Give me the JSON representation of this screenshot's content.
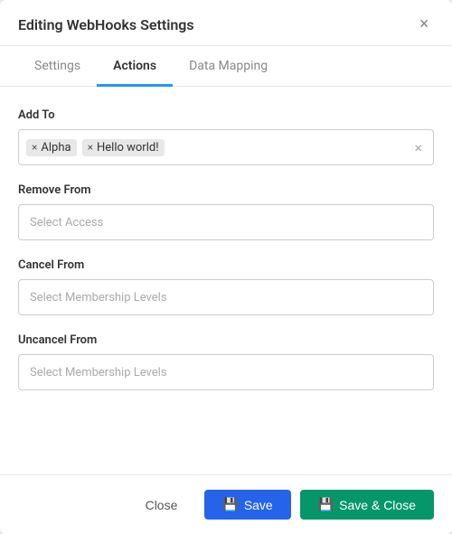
{
  "modal": {
    "title": "Editing WebHooks Settings",
    "close_label": "×"
  },
  "tabs": [
    {
      "id": "settings",
      "label": "Settings",
      "active": false
    },
    {
      "id": "actions",
      "label": "Actions",
      "active": true
    },
    {
      "id": "data-mapping",
      "label": "Data Mapping",
      "active": false
    }
  ],
  "fields": {
    "add_to": {
      "label": "Add To",
      "tags": [
        {
          "id": "alpha",
          "label": "Alpha"
        },
        {
          "id": "hello-world",
          "label": "Hello world!"
        }
      ]
    },
    "remove_from": {
      "label": "Remove From",
      "placeholder": "Select Access"
    },
    "cancel_from": {
      "label": "Cancel From",
      "placeholder": "Select Membership Levels"
    },
    "uncancel_from": {
      "label": "Uncancel From",
      "placeholder": "Select Membership Levels"
    }
  },
  "footer": {
    "close_label": "Close",
    "save_label": "Save",
    "save_close_label": "Save & Close"
  }
}
